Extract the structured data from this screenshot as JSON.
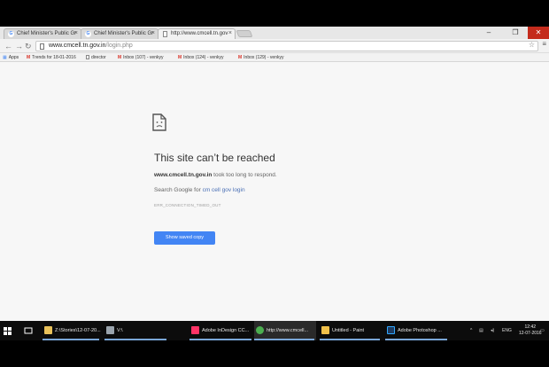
{
  "browser": {
    "tabs": [
      {
        "label": "Chief Minister's Public Gr",
        "favicon": "google-icon"
      },
      {
        "label": "Chief Minister's Public Gr",
        "favicon": "google-icon"
      },
      {
        "label": "http://www.cmcell.tn.gov",
        "favicon": "page-icon"
      }
    ],
    "url_domain": "www.cmcell.tn.gov.in",
    "url_path": "/login.php",
    "bookmarks": [
      {
        "label": "Apps",
        "icon": "apps-icon"
      },
      {
        "label": "Trends for 18-01-2016",
        "icon": "gmail-icon"
      },
      {
        "label": "director",
        "icon": "page-icon"
      },
      {
        "label": "Inbox (107) - venkyy",
        "icon": "gmail-icon"
      },
      {
        "label": "Inbox (124) - venkyy",
        "icon": "gmail-icon"
      },
      {
        "label": "Inbox (129) - venkyy",
        "icon": "gmail-icon"
      }
    ]
  },
  "error": {
    "title": "This site can’t be reached",
    "host": "www.cmcell.tn.gov.in",
    "message_rest": " took too long to respond.",
    "search_prefix": "Search Google for ",
    "search_link": "cm cell gov login",
    "code": "ERR_CONNECTION_TIMED_OUT",
    "button": "Show saved copy"
  },
  "taskbar": {
    "items": [
      {
        "label": "Z:\\Stories\\12-07-20...",
        "icon": "folder-icon"
      },
      {
        "label": "V:\\",
        "icon": "drive-icon"
      },
      {
        "label": "Adobe InDesign CC...",
        "icon": "indesign-icon"
      },
      {
        "label": "http://www.cmcell...",
        "icon": "chrome-icon"
      },
      {
        "label": "Untitled - Paint",
        "icon": "paint-icon"
      },
      {
        "label": "Adobe Photoshop ...",
        "icon": "photoshop-icon"
      }
    ],
    "language": "ENG",
    "time": "12:42",
    "date": "12-07-2016"
  },
  "colors": {
    "accent": "#4285f4",
    "link": "#4a6fb5",
    "gmail": "#d93025"
  }
}
